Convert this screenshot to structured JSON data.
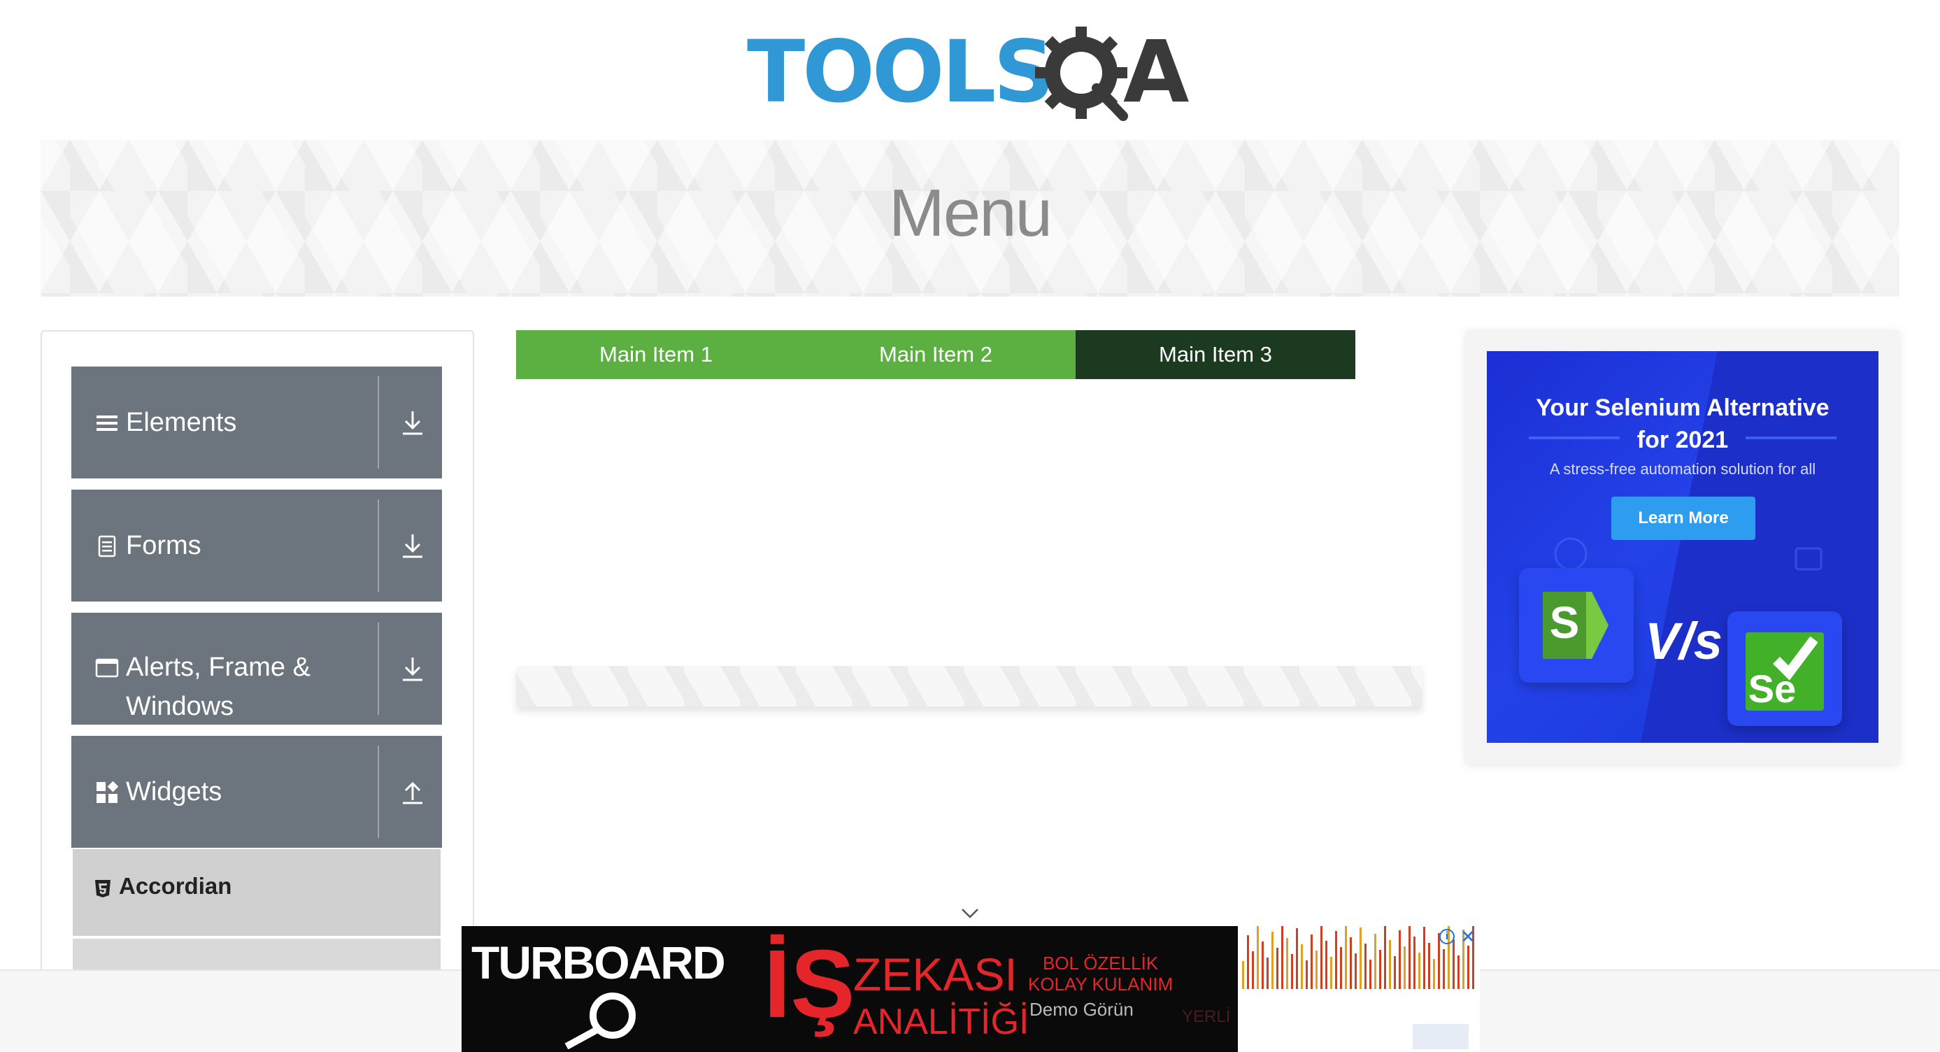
{
  "logo": {
    "word": "TOOLS",
    "letter": "A"
  },
  "banner": {
    "title": "Menu"
  },
  "sidebar": {
    "groups": [
      {
        "label": "Elements",
        "icon": "hamburger-icon",
        "arrow": "download-arrow-icon"
      },
      {
        "label": "Forms",
        "icon": "document-icon",
        "arrow": "download-arrow-icon"
      },
      {
        "label": "Alerts, Frame &",
        "label2": "Windows",
        "icon": "window-icon",
        "arrow": "download-arrow-icon"
      },
      {
        "label": "Widgets",
        "icon": "widgets-icon",
        "arrow": "upload-arrow-icon"
      }
    ],
    "sub_items": [
      {
        "label": "Accordian",
        "icon": "html5-icon"
      }
    ]
  },
  "nav": {
    "items": [
      "Main Item 1",
      "Main Item 2",
      "Main Item 3"
    ]
  },
  "right_ad": {
    "headline_1": "Your Selenium Alternative",
    "headline_2": "for 2021",
    "subtitle": "A stress-free automation solution for all",
    "button": "Learn More",
    "vs": "V/s",
    "tile_left": "S",
    "tile_right": "Se",
    "colors": {
      "bg": "#2342e8",
      "button": "#2e9df0",
      "katalon": "#7ac943",
      "selenium": "#43b02a"
    }
  },
  "bottom_ad": {
    "brand": "TURBOARD",
    "is": "İŞ",
    "zekasi": "ZEKASI",
    "analitigi": "ANALİTİĞİ",
    "feature_1": "BOL ÖZELLİK",
    "feature_2": "KOLAY KULANIM",
    "demo": "Demo Görün",
    "yerli": "YERLİ",
    "colors": {
      "red": "#e4262a"
    }
  },
  "colors": {
    "nav_green": "#5cb041",
    "nav_dark": "#1b3a20",
    "sidebar_gray": "#6c757d",
    "logo_blue": "#2f98d5"
  }
}
